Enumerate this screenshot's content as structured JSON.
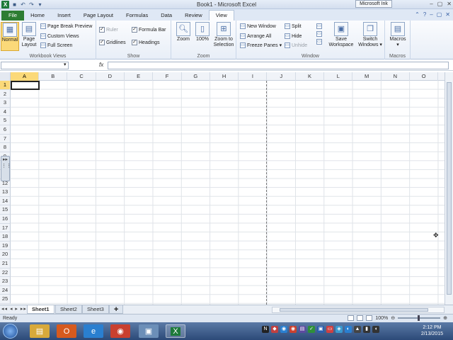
{
  "window": {
    "title": "Book1 - Microsoft Excel",
    "ink_label": "Microsoft Ink",
    "controls": [
      "–",
      "▢",
      "✕"
    ]
  },
  "ribbon_tabs": [
    "File",
    "Home",
    "Insert",
    "Page Layout",
    "Formulas",
    "Data",
    "Review",
    "View"
  ],
  "active_tab": "View",
  "groups": {
    "workbook_views": {
      "label": "Workbook Views",
      "normal": "Normal",
      "page_layout": "Page Layout",
      "page_break": "Page Break Preview",
      "custom_views": "Custom Views",
      "full_screen": "Full Screen"
    },
    "show": {
      "label": "Show",
      "ruler": "Ruler",
      "formula_bar": "Formula Bar",
      "gridlines": "Gridlines",
      "headings": "Headings"
    },
    "zoom": {
      "label": "Zoom",
      "zoom": "Zoom",
      "hundred": "100%",
      "zoom_to_selection": "Zoom to Selection"
    },
    "window": {
      "label": "Window",
      "new_window": "New Window",
      "arrange_all": "Arrange All",
      "freeze_panes": "Freeze Panes",
      "split": "Split",
      "hide": "Hide",
      "unhide": "Unhide",
      "save_workspace": "Save Workspace",
      "switch_windows": "Switch Windows"
    },
    "macros": {
      "label": "Macros",
      "macros": "Macros"
    }
  },
  "formula_bar": {
    "name_box": "",
    "fx": "fx",
    "value": ""
  },
  "columns": [
    "A",
    "B",
    "C",
    "D",
    "E",
    "F",
    "G",
    "H",
    "I",
    "J",
    "K",
    "L",
    "M",
    "N",
    "O"
  ],
  "rows": [
    "1",
    "2",
    "3",
    "4",
    "5",
    "6",
    "7",
    "8",
    "9",
    "10",
    "11",
    "12",
    "13",
    "14",
    "15",
    "16",
    "17",
    "18",
    "19",
    "20",
    "21",
    "22",
    "23",
    "24",
    "25"
  ],
  "sheets": [
    "Sheet1",
    "Sheet2",
    "Sheet3"
  ],
  "active_sheet": "Sheet1",
  "status": {
    "left": "Ready",
    "zoom": "100%"
  },
  "taskbar": {
    "time": "2:12 PM",
    "date": "2/13/2015"
  },
  "colors": {
    "file_tab": "#2d7d32",
    "selection_header": "#fbd979",
    "taskbar": "#2c4a78"
  }
}
